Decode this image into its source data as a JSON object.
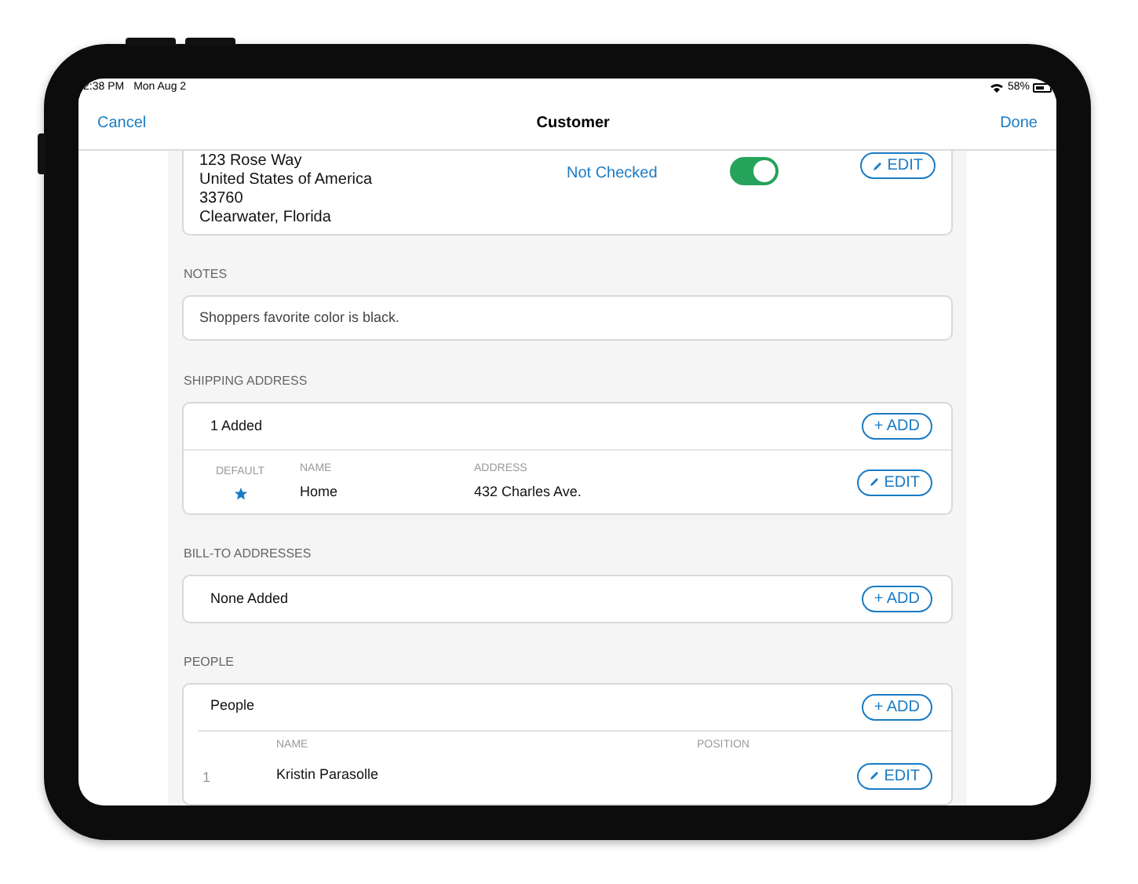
{
  "status_bar": {
    "time": "2:38 PM",
    "date": "Mon Aug 2",
    "battery": "58%"
  },
  "nav_bar": {
    "left": "Cancel",
    "title": "Customer",
    "right": "Done"
  },
  "address_card": {
    "lines": [
      "123 Rose Way",
      "United States of America",
      "33760",
      "Clearwater, Florida"
    ],
    "check_status": "Not Checked",
    "toggle": {
      "on": true
    },
    "edit_button": "EDIT"
  },
  "notes": {
    "label": "NOTES",
    "value": "Shoppers favorite color is black."
  },
  "shipping_address": {
    "label": "SHIPPING ADDRESS",
    "summary": "1 Added",
    "add_button": "+ ADD",
    "columns": [
      "DEFAULT",
      "NAME",
      "ADDRESS"
    ],
    "rows": [
      {
        "default": true,
        "name": "Home",
        "address": "432 Charles Ave.",
        "edit_button": "EDIT"
      }
    ]
  },
  "bill_to_addresses": {
    "label": "BILL-TO ADDRESSES",
    "summary": "None Added",
    "add_button": "+ ADD"
  },
  "people": {
    "label": "PEOPLE",
    "summary": "People",
    "add_button": "+ ADD",
    "columns": [
      "NAME",
      "POSITION"
    ],
    "rows": [
      {
        "number": "1",
        "name": "Kristin Parasolle",
        "edit_button": "EDIT"
      }
    ]
  }
}
